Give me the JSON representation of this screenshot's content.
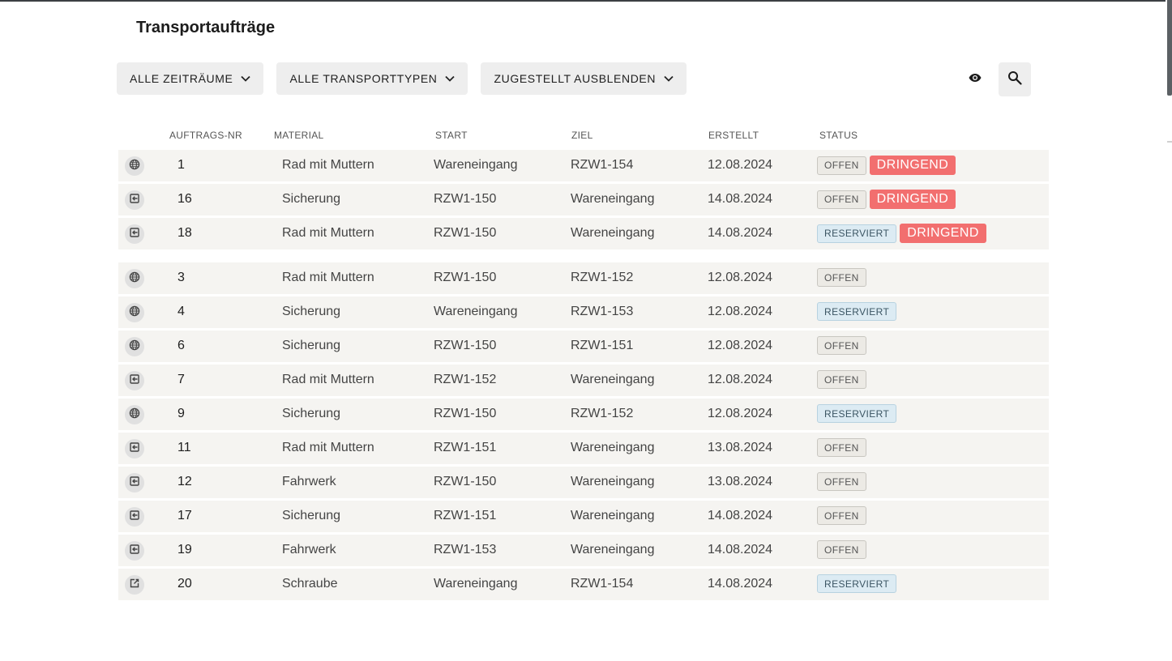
{
  "page": {
    "title": "Transportaufträge"
  },
  "filters": [
    {
      "label": "ALLE ZEITRÄUME"
    },
    {
      "label": "ALLE TRANSPORTTYPEN"
    },
    {
      "label": "ZUGESTELLT AUSBLENDEN"
    }
  ],
  "toolbar": {
    "visibility_icon": "eye-icon",
    "search_icon": "search-icon"
  },
  "table": {
    "columns": {
      "nr": "AUFTRAGS-NR",
      "material": "MATERIAL",
      "start": "START",
      "ziel": "ZIEL",
      "erstellt": "ERSTELLT",
      "status": "STATUS"
    },
    "urgent_rows": [
      {
        "type_icon": "globe-icon",
        "nr": "1",
        "material": "Rad mit Muttern",
        "start": "Wareneingang",
        "ziel": "RZW1-154",
        "erstellt": "12.08.2024",
        "status": "OFFEN",
        "urgent": "DRINGEND"
      },
      {
        "type_icon": "exit-icon",
        "nr": "16",
        "material": "Sicherung",
        "start": "RZW1-150",
        "ziel": "Wareneingang",
        "erstellt": "14.08.2024",
        "status": "OFFEN",
        "urgent": "DRINGEND"
      },
      {
        "type_icon": "exit-icon",
        "nr": "18",
        "material": "Rad mit Muttern",
        "start": "RZW1-150",
        "ziel": "Wareneingang",
        "erstellt": "14.08.2024",
        "status": "RESERVIERT",
        "urgent": "DRINGEND"
      }
    ],
    "rows": [
      {
        "type_icon": "globe-icon",
        "nr": "3",
        "material": "Rad mit Muttern",
        "start": "RZW1-150",
        "ziel": "RZW1-152",
        "erstellt": "12.08.2024",
        "status": "OFFEN"
      },
      {
        "type_icon": "globe-icon",
        "nr": "4",
        "material": "Sicherung",
        "start": "Wareneingang",
        "ziel": "RZW1-153",
        "erstellt": "12.08.2024",
        "status": "RESERVIERT"
      },
      {
        "type_icon": "globe-icon",
        "nr": "6",
        "material": "Sicherung",
        "start": "RZW1-150",
        "ziel": "RZW1-151",
        "erstellt": "12.08.2024",
        "status": "OFFEN"
      },
      {
        "type_icon": "exit-icon",
        "nr": "7",
        "material": "Rad mit Muttern",
        "start": "RZW1-152",
        "ziel": "Wareneingang",
        "erstellt": "12.08.2024",
        "status": "OFFEN"
      },
      {
        "type_icon": "globe-icon",
        "nr": "9",
        "material": "Sicherung",
        "start": "RZW1-150",
        "ziel": "RZW1-152",
        "erstellt": "12.08.2024",
        "status": "RESERVIERT"
      },
      {
        "type_icon": "exit-icon",
        "nr": "11",
        "material": "Rad mit Muttern",
        "start": "RZW1-151",
        "ziel": "Wareneingang",
        "erstellt": "13.08.2024",
        "status": "OFFEN"
      },
      {
        "type_icon": "exit-icon",
        "nr": "12",
        "material": "Fahrwerk",
        "start": "RZW1-150",
        "ziel": "Wareneingang",
        "erstellt": "13.08.2024",
        "status": "OFFEN"
      },
      {
        "type_icon": "exit-icon",
        "nr": "17",
        "material": "Sicherung",
        "start": "RZW1-151",
        "ziel": "Wareneingang",
        "erstellt": "14.08.2024",
        "status": "OFFEN"
      },
      {
        "type_icon": "exit-icon",
        "nr": "19",
        "material": "Fahrwerk",
        "start": "RZW1-153",
        "ziel": "Wareneingang",
        "erstellt": "14.08.2024",
        "status": "OFFEN"
      },
      {
        "type_icon": "external-link-icon",
        "nr": "20",
        "material": "Schraube",
        "start": "Wareneingang",
        "ziel": "RZW1-154",
        "erstellt": "14.08.2024",
        "status": "RESERVIERT"
      }
    ]
  },
  "colors": {
    "urgent": "#f26f6f",
    "row_bg": "#f5f4f1",
    "reserved_bg": "#dcebf3"
  }
}
